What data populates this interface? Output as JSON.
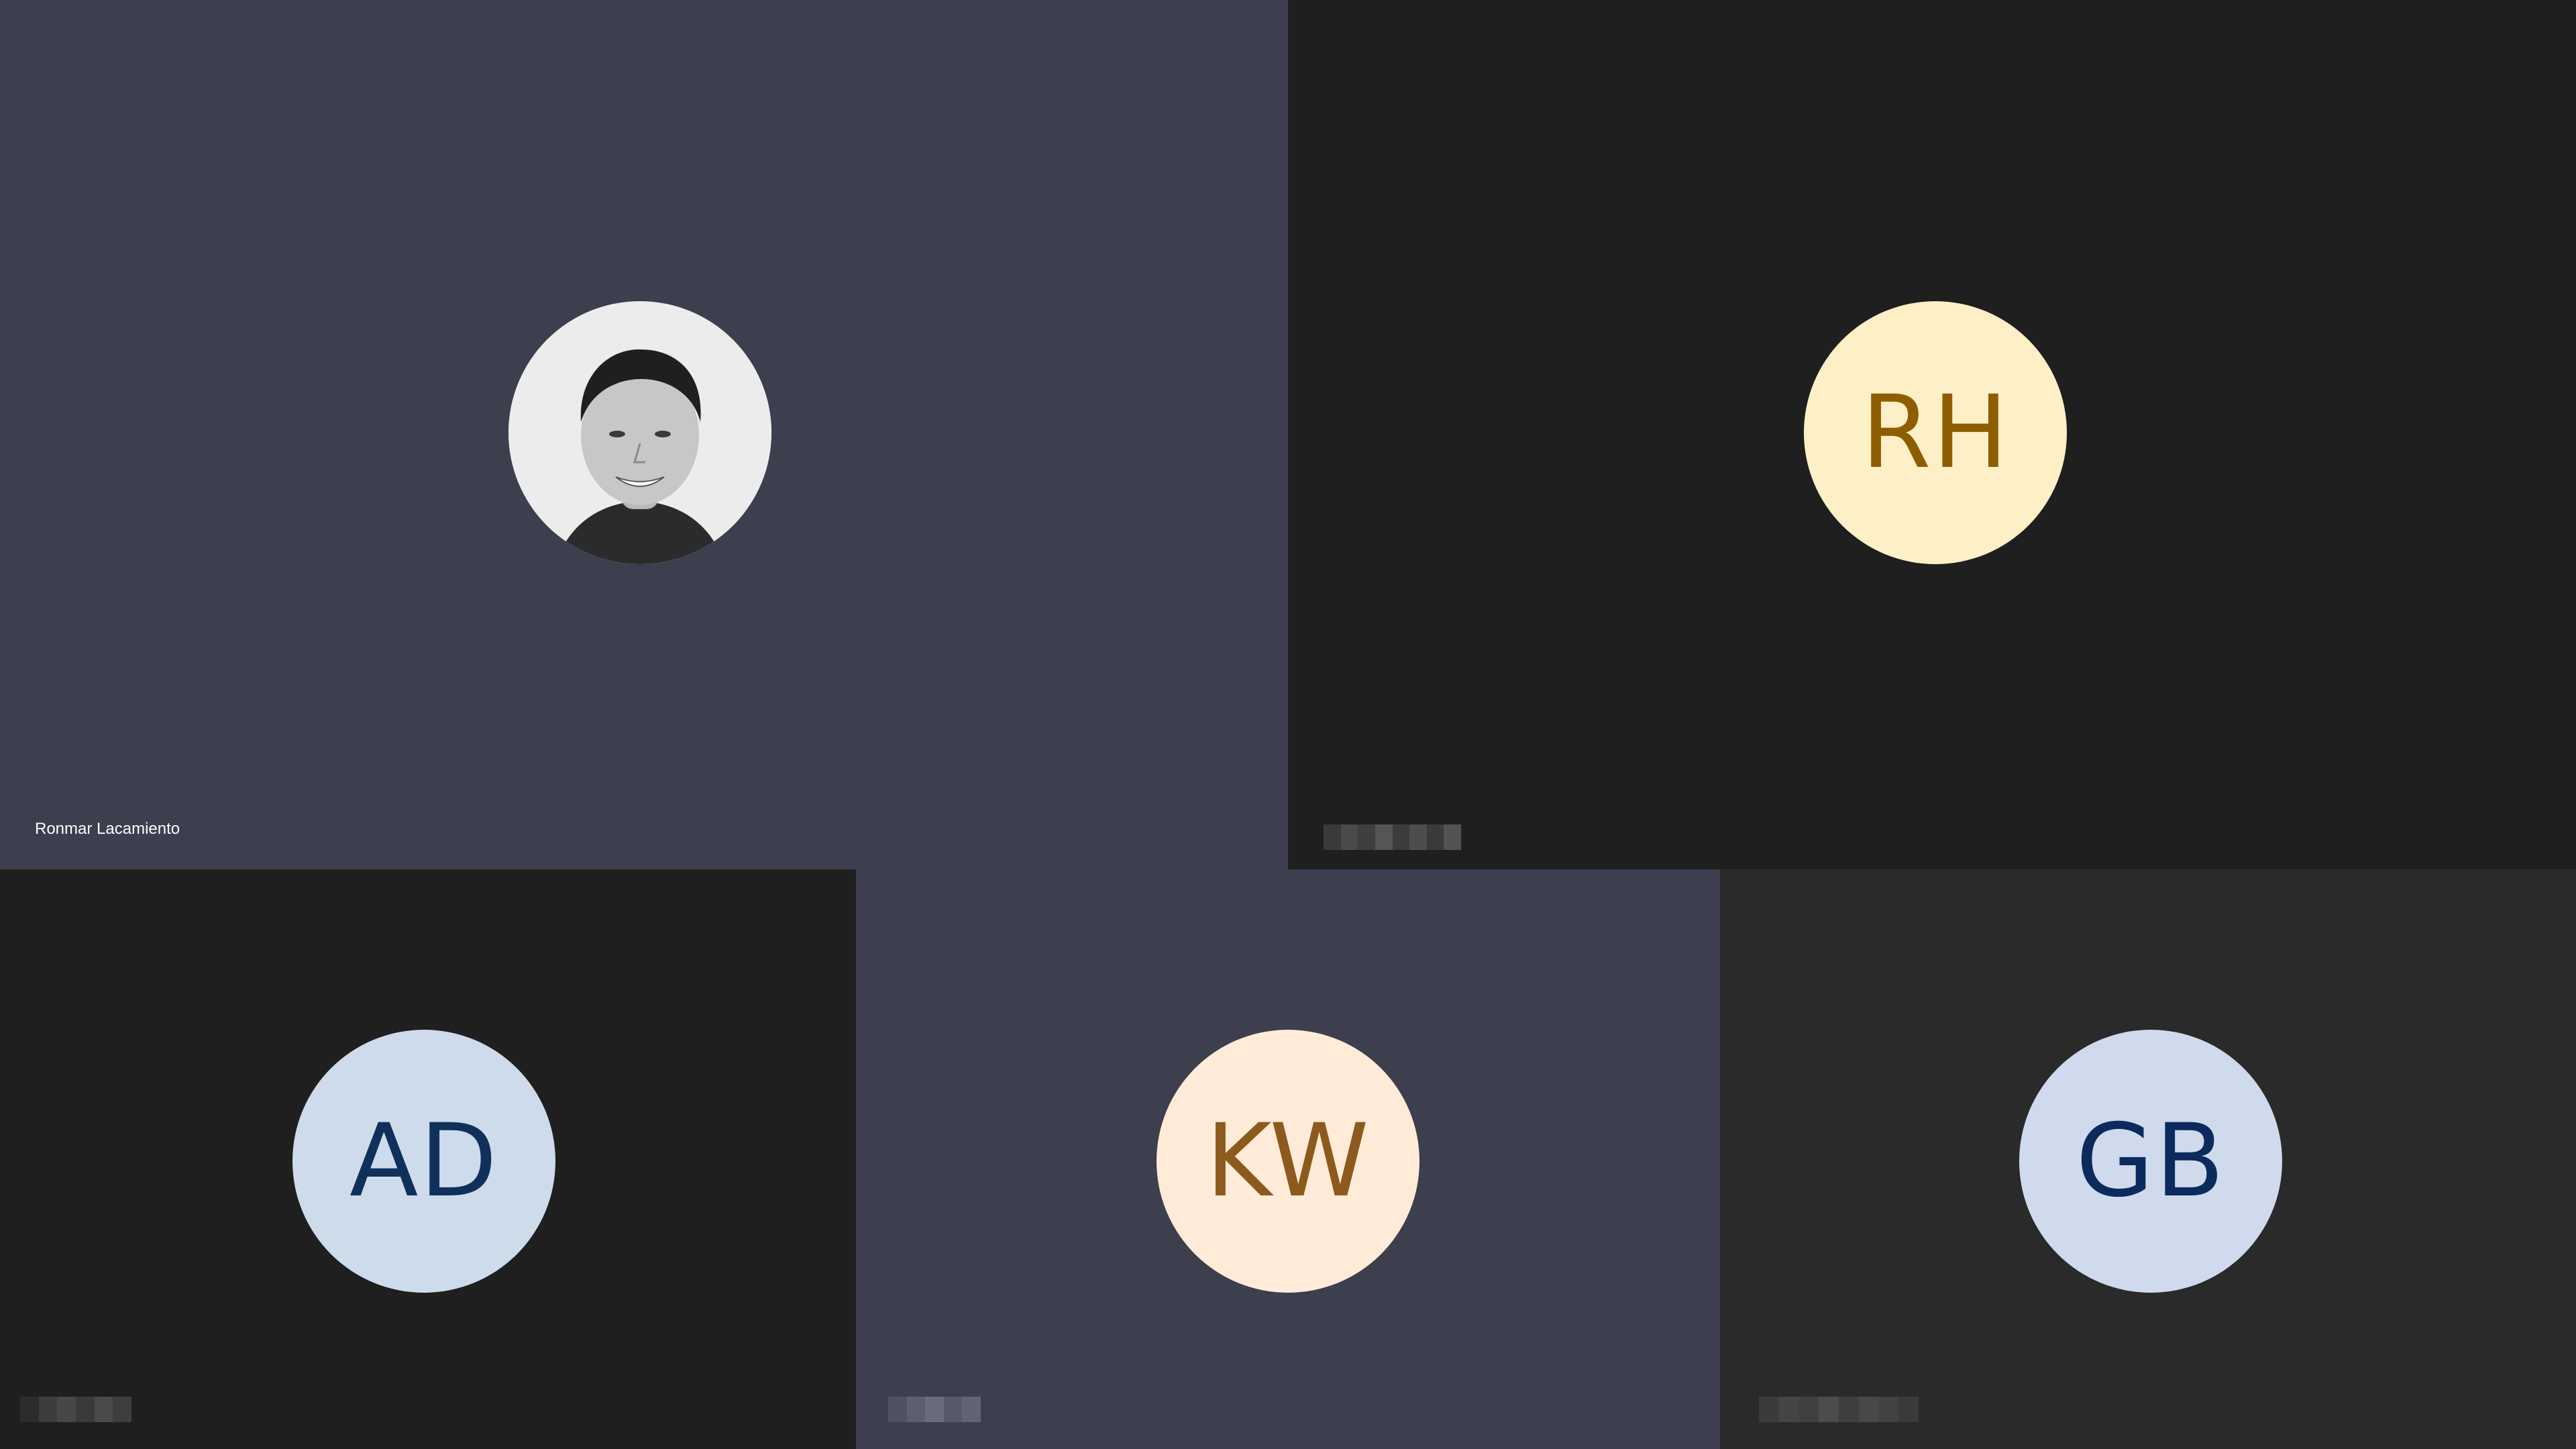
{
  "participants": [
    {
      "id": "ronmar",
      "name": "Ronmar Lacamiento",
      "avatar_type": "photo",
      "tile_color": "#3d3e4e"
    },
    {
      "id": "rh",
      "initials": "RH",
      "name": "",
      "name_redacted": true,
      "tile_color": "#1f1f1f",
      "avatar_bg": "#fdf0c7",
      "initials_color": "#8e5d00"
    },
    {
      "id": "ad",
      "initials": "AD",
      "name": "",
      "name_redacted": true,
      "tile_color": "#1f1f1f",
      "avatar_bg": "#cedbeb",
      "initials_color": "#10305c"
    },
    {
      "id": "kw",
      "initials": "KW",
      "name": "",
      "name_redacted": true,
      "tile_color": "#3d3e4e",
      "avatar_bg": "#ffebd8",
      "initials_color": "#8c5a1c"
    },
    {
      "id": "gb",
      "initials": "GB",
      "name": "",
      "name_redacted": true,
      "tile_color": "#2a2a2a",
      "avatar_bg": "#cfdbec",
      "initials_color": "#0b2a5e"
    }
  ]
}
